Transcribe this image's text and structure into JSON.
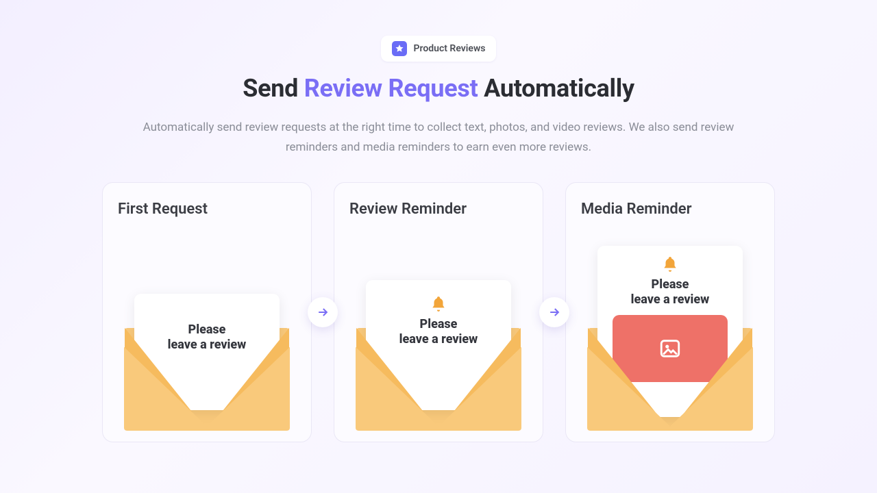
{
  "badge": {
    "label": "Product Reviews"
  },
  "headline": {
    "pre": "Send ",
    "accent": "Review Request",
    "post": " Automatically"
  },
  "subhead": "Automatically send review requests at the right time to collect text, photos, and video reviews. We also send review reminders and media reminders to earn even more reviews.",
  "cards": [
    {
      "title": "First Request",
      "letter_line1": "Please",
      "letter_line2": "leave a review",
      "has_bell": false,
      "has_media": false
    },
    {
      "title": "Review Reminder",
      "letter_line1": "Please",
      "letter_line2": "leave a review",
      "has_bell": true,
      "has_media": false
    },
    {
      "title": "Media Reminder",
      "letter_line1": "Please",
      "letter_line2": "leave a review",
      "has_bell": true,
      "has_media": true
    }
  ],
  "colors": {
    "accent": "#7a6ef5",
    "envelope": "#f9c97b",
    "envelope_dark": "#f2a53a",
    "media": "#ee7168"
  }
}
